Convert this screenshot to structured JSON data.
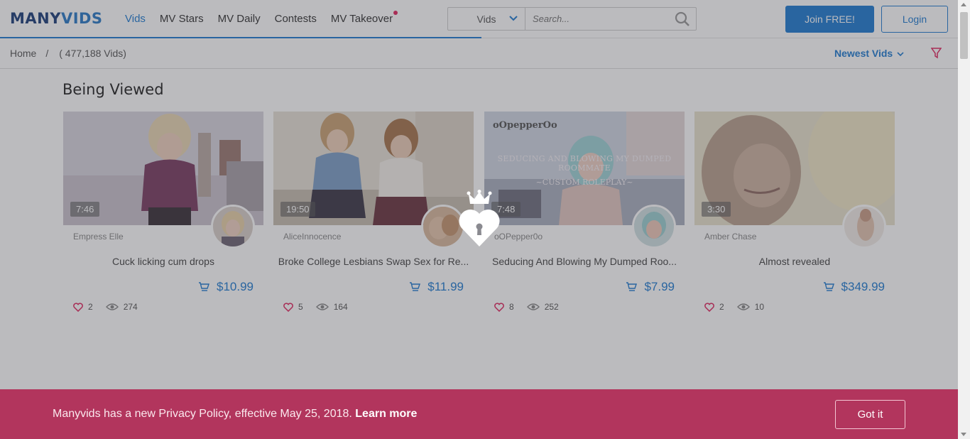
{
  "brand": {
    "logo_part1": "MANY",
    "logo_part2": "VIDS"
  },
  "nav": [
    {
      "label": "Vids",
      "active": true
    },
    {
      "label": "MV Stars"
    },
    {
      "label": "MV Daily"
    },
    {
      "label": "Contests"
    },
    {
      "label": "MV Takeover",
      "has_dot": true
    }
  ],
  "search": {
    "category": "Vids",
    "placeholder": "Search..."
  },
  "auth": {
    "join_label": "Join FREE!",
    "login_label": "Login"
  },
  "breadcrumb": {
    "home": "Home",
    "separator": "/",
    "count": "( 477,188 Vids)"
  },
  "sort": {
    "label": "Newest Vids"
  },
  "section": {
    "title": "Being Viewed"
  },
  "cards": [
    {
      "duration": "7:46",
      "creator": "Empress Elle",
      "title": "Cuck licking cum drops",
      "price": "$10.99",
      "likes": "2",
      "views": "274"
    },
    {
      "duration": "19:50",
      "creator": "AliceInnocence",
      "title": "Broke College Lesbians Swap Sex for Re...",
      "price": "$11.99",
      "likes": "5",
      "views": "164"
    },
    {
      "duration": "7:48",
      "creator": "oOPepper0o",
      "title": "Seducing And Blowing My Dumped Roo...",
      "price": "$7.99",
      "likes": "8",
      "views": "252",
      "thumb_caption_1": "oOpepperOo",
      "thumb_caption_2": "SEDUCING AND BLOWING MY DUMPED ROOMMATE",
      "thumb_caption_3": "~CUSTOM ROLEPLAY~"
    },
    {
      "duration": "3:30",
      "creator": "Amber Chase",
      "title": "Almost revealed",
      "price": "$349.99",
      "likes": "2",
      "views": "10"
    }
  ],
  "banner": {
    "message": "Manyvids has a new Privacy Policy, effective May 25, 2018.",
    "link": "Learn more",
    "button": "Got it"
  },
  "colors": {
    "brand_blue": "#1f7bd1",
    "banner_pink": "#b2355d",
    "like_pink": "#e0245e"
  }
}
